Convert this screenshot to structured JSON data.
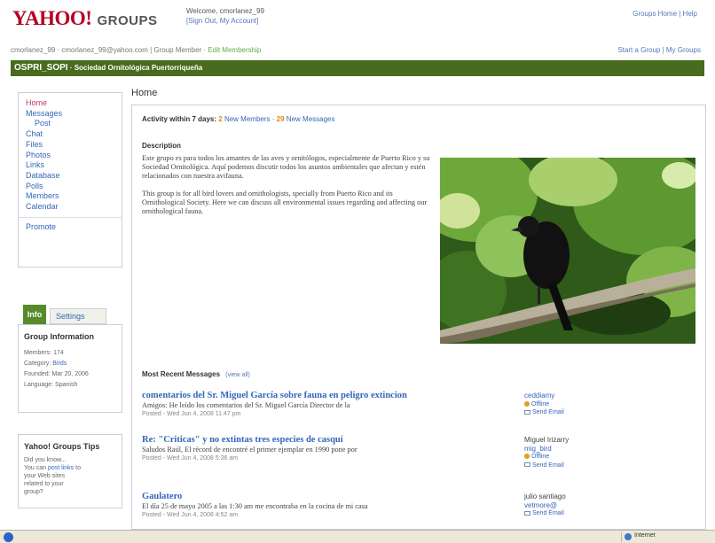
{
  "header": {
    "logo_yahoo": "YAHOO!",
    "logo_groups": "GROUPS",
    "welcome_line1": "Welcome, cmorlanez_99",
    "welcome_line2": "[Sign Out, My Account]",
    "top_links": "Groups Home | Help"
  },
  "user_bar": {
    "left": "cmorlanez_99 · cmorlanez_99@yahoo.com | Group Member · ",
    "edit_link": "Edit Membership",
    "right": "Start a Group | My Groups"
  },
  "group_bar": {
    "id": "OSPRI_SOPI",
    "name": " · Sociedad Ornitológica Puertorriqueña"
  },
  "sidebar": {
    "nav": [
      {
        "label": "Home",
        "active": true,
        "sub": false
      },
      {
        "label": "Messages",
        "active": false,
        "sub": false
      },
      {
        "label": "Post",
        "active": false,
        "sub": true
      },
      {
        "label": "Chat",
        "active": false,
        "sub": false
      },
      {
        "label": "Files",
        "active": false,
        "sub": false
      },
      {
        "label": "Photos",
        "active": false,
        "sub": false
      },
      {
        "label": "Links",
        "active": false,
        "sub": false
      },
      {
        "label": "Database",
        "active": false,
        "sub": false
      },
      {
        "label": "Polls",
        "active": false,
        "sub": false
      },
      {
        "label": "Members",
        "active": false,
        "sub": false
      },
      {
        "label": "Calendar",
        "active": false,
        "sub": false
      }
    ],
    "promote": "Promote",
    "tabs": {
      "info": "Info",
      "settings": "Settings"
    },
    "group_info": {
      "heading": "Group Information",
      "members_label": "Members: ",
      "members_value": "174",
      "category_label": "Category: ",
      "category_value": "Birds",
      "founded": "Founded: Mar 20, 2006",
      "language": "Language: Spanish"
    },
    "tips": {
      "heading": "Yahoo! Groups Tips",
      "line1": "Did you know...",
      "line2": "You can ",
      "line2_link": "post links",
      "line2_rest": " to",
      "line3": "your Web sites",
      "line4": "related to your",
      "line5": "group?"
    }
  },
  "main": {
    "title": "Home",
    "activity_label": "Activity within 7 days: ",
    "new_members_count": "2",
    "new_members_label": "New Members",
    "new_messages_count": "29",
    "new_messages_label": "New Messages",
    "description_label": "Description",
    "description_p1": "Este grupo es para todos los amantes de las aves y ornitólogos, especialmente de Puerto Rico y su Sociedad Ornitológica. Aquí podemos discutir todos los asuntos ambientales que afectan y estén relacionados con nuestra avifauna.",
    "description_p2": "This group is for all bird lovers and ornithologists, specially from Puerto Rico and its Ornithological Society. Here we can discuss all environmental issues regarding and affecting our ornithological fauna.",
    "recent_heading": "Most Recent Messages",
    "recent_view_all": "(view all)",
    "messages": [
      {
        "title": "comentarios del Sr. Miguel García sobre fauna en peligro extincion",
        "snippet": "Amigos: He leído los comentarios del Sr. Miguel García Director de la",
        "meta": "Posted - Wed Jun 4, 2008 11:47 pm",
        "author": "ceddiamy",
        "author_link": true,
        "status": "Offline",
        "email": "Send Email"
      },
      {
        "title": "Re: \"Criticas\" y no extintas tres especies de casquí",
        "snippet": "Saludos Raúl, El récord de encontré el primer ejemplar en 1990 pone por",
        "meta": "Posted - Wed Jun 4, 2008 5:36 am",
        "author": "Miguel Irizarry",
        "author_sub": "mig_bird",
        "author_link": false,
        "status": "Offline",
        "email": "Send Email"
      },
      {
        "title": "Gaulatero",
        "snippet": "El día 25 de mayo 2005 a las 1:30 am me encontraba en la cocina de mi casa",
        "meta": "Posted - Wed Jun 4, 2008 4:52 am",
        "author": "julio santiago",
        "author_sub": "vetmore@",
        "author_link": false,
        "status": "",
        "email": "Send Email"
      }
    ]
  },
  "status_bar": {
    "zone": "Internet"
  },
  "colors": {
    "group_bar": "#486b1e",
    "yahoo_red": "#b40024",
    "link": "#3366bb",
    "count_orange": "#e08a00"
  }
}
